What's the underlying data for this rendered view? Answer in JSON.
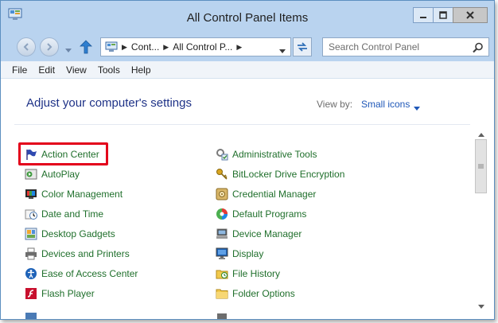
{
  "window": {
    "title": "All Control Panel Items"
  },
  "address": {
    "crumbs": [
      "Cont...",
      "All Control P..."
    ],
    "search_placeholder": "Search Control Panel"
  },
  "menu": {
    "items": [
      "File",
      "Edit",
      "View",
      "Tools",
      "Help"
    ]
  },
  "content": {
    "heading": "Adjust your computer's settings",
    "view_by_label": "View by:",
    "view_by_value": "Small icons",
    "highlighted_item": "Action Center",
    "left_column": [
      {
        "label": "Action Center",
        "icon": "flag-icon"
      },
      {
        "label": "AutoPlay",
        "icon": "autoplay-icon"
      },
      {
        "label": "Color Management",
        "icon": "color-management-icon"
      },
      {
        "label": "Date and Time",
        "icon": "clock-icon"
      },
      {
        "label": "Desktop Gadgets",
        "icon": "gadgets-icon"
      },
      {
        "label": "Devices and Printers",
        "icon": "printer-icon"
      },
      {
        "label": "Ease of Access Center",
        "icon": "ease-of-access-icon"
      },
      {
        "label": "Flash Player",
        "icon": "flash-icon"
      }
    ],
    "right_column": [
      {
        "label": "Administrative Tools",
        "icon": "admin-tools-icon"
      },
      {
        "label": "BitLocker Drive Encryption",
        "icon": "bitlocker-key-icon"
      },
      {
        "label": "Credential Manager",
        "icon": "credential-vault-icon"
      },
      {
        "label": "Default Programs",
        "icon": "default-programs-icon"
      },
      {
        "label": "Device Manager",
        "icon": "device-manager-icon"
      },
      {
        "label": "Display",
        "icon": "display-icon"
      },
      {
        "label": "File History",
        "icon": "file-history-icon"
      },
      {
        "label": "Folder Options",
        "icon": "folder-icon"
      }
    ]
  },
  "colors": {
    "chrome": "#b9d3ef",
    "link_green": "#1f6f2b",
    "heading_blue": "#1e3287",
    "highlight_red": "#e3001b"
  }
}
